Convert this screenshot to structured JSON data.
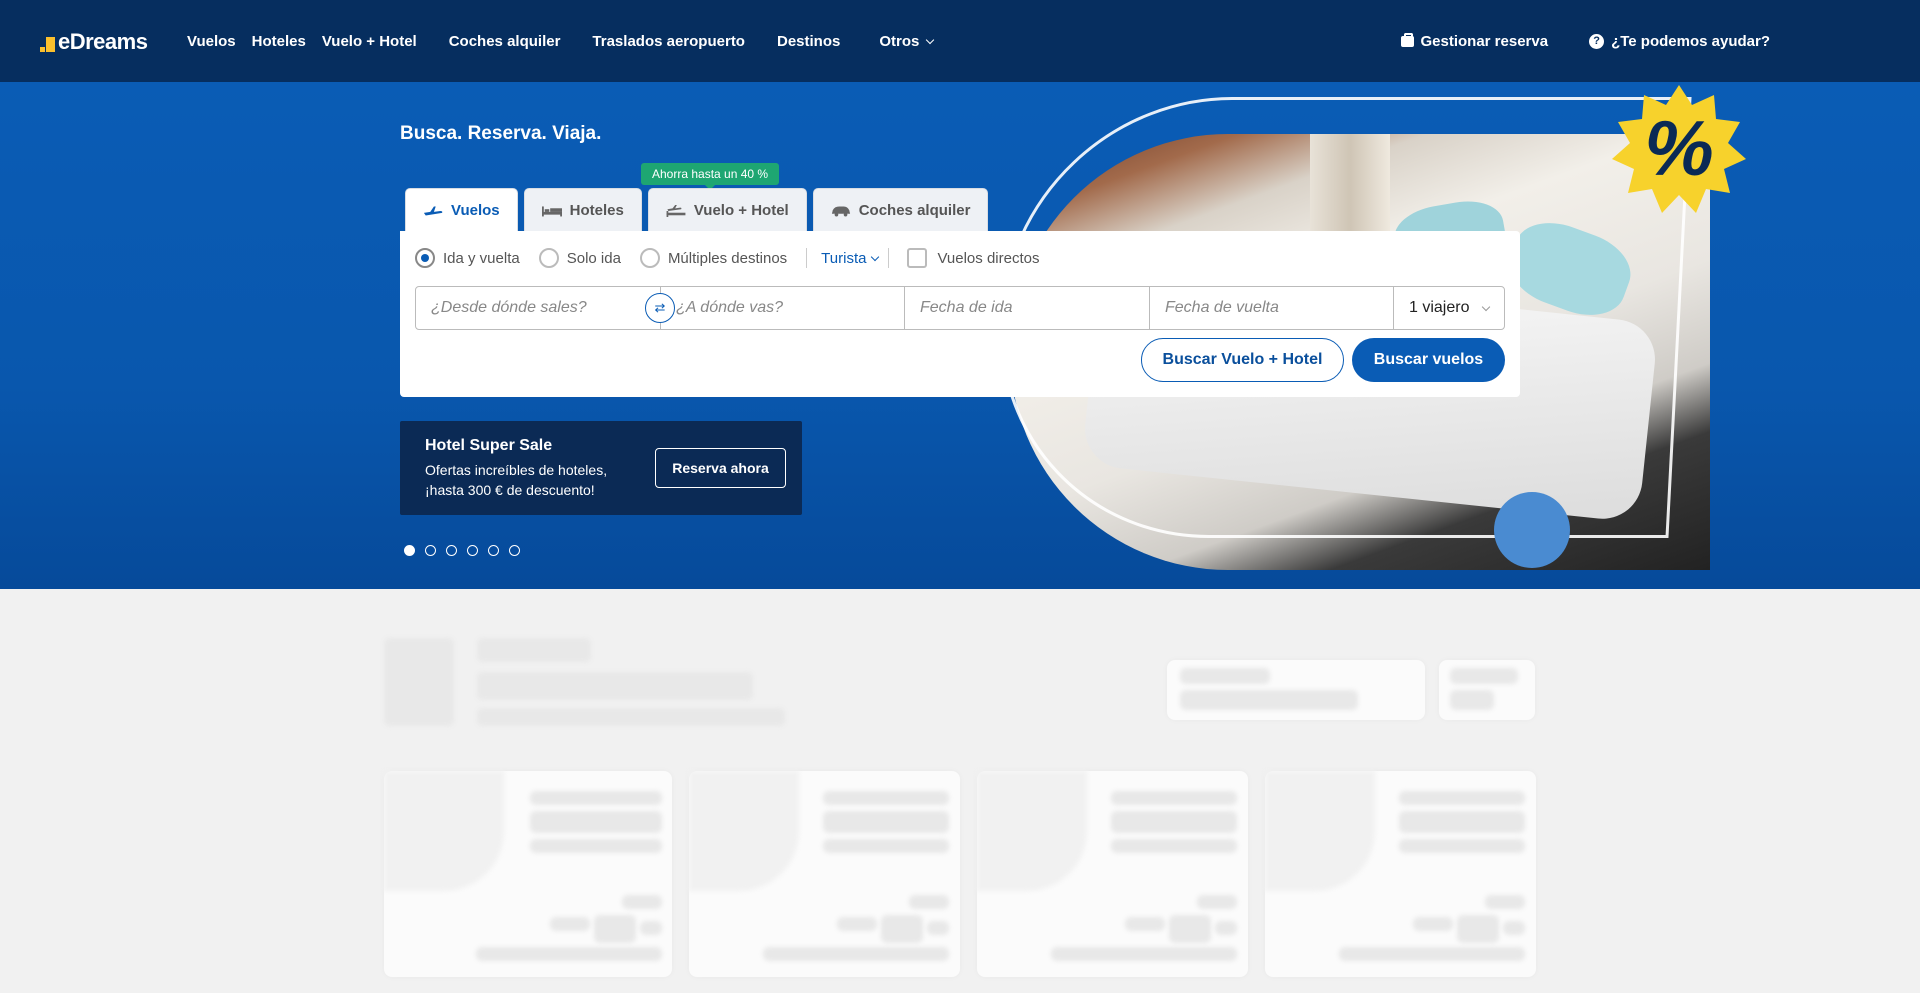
{
  "brand": {
    "name": "eDreams"
  },
  "nav": {
    "links": [
      {
        "label": "Vuelos",
        "margin": 16
      },
      {
        "label": "Hoteles",
        "margin": 16
      },
      {
        "label": "Vuelo + Hotel",
        "margin": 32
      },
      {
        "label": "Coches alquiler",
        "margin": 32
      },
      {
        "label": "Traslados aeropuerto",
        "margin": 32
      },
      {
        "label": "Destinos",
        "margin": 39
      }
    ],
    "others_label": "Otros",
    "manage_label": "Gestionar reserva",
    "help_label": "¿Te podemos ayudar?"
  },
  "hero": {
    "title": "Busca. Reserva. Viaja.",
    "badge_symbol": "%",
    "colors": {
      "accent": "#0a5cb5",
      "nav_bg": "#062e5f",
      "promo_green": "#1ea672",
      "badge_yellow": "#f7d22c"
    }
  },
  "search": {
    "promo_chip": "Ahorra hasta un 40 %",
    "tabs": [
      {
        "label": "Vuelos",
        "icon": "plane-icon",
        "active": true
      },
      {
        "label": "Hoteles",
        "icon": "bed-icon",
        "active": false
      },
      {
        "label": "Vuelo + Hotel",
        "icon": "plane-bed-icon",
        "active": false
      },
      {
        "label": "Coches alquiler",
        "icon": "car-icon",
        "active": false
      }
    ],
    "trip_types": [
      "Ida y vuelta",
      "Solo ida",
      "Múltiples destinos"
    ],
    "cabin_class": "Turista",
    "direct_label": "Vuelos directos",
    "from_placeholder": "¿Desde dónde sales?",
    "to_placeholder": "¿A dónde vas?",
    "depart_placeholder": "Fecha de ida",
    "return_placeholder": "Fecha de vuelta",
    "travellers": "1 viajero",
    "btn_package": "Buscar Vuelo + Hotel",
    "btn_search": "Buscar vuelos"
  },
  "sale": {
    "title": "Hotel Super Sale",
    "desc": "Ofertas increíbles de hoteles, ¡hasta 300 € de descuento!",
    "cta": "Reserva ahora"
  },
  "carousel": {
    "count": 6,
    "active": 0
  }
}
